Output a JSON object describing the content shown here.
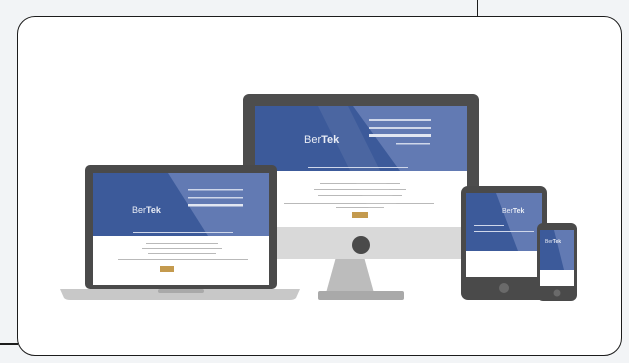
{
  "image": {
    "description_visible": "Responsive device mockup showing the BerTek website on desktop, laptop, tablet and phone",
    "brand": "BerTek",
    "brand_prefix": "Ber",
    "brand_suffix": "Tek",
    "colors": {
      "site_blue": "#3c5a9a",
      "site_blue_light": "#6f86bb",
      "device_dark": "#555555",
      "device_frame": "#4a4a4a",
      "stand": "#bdbdbd",
      "laptop_base": "#c6c6c6",
      "background": "#f2f4f6"
    }
  }
}
